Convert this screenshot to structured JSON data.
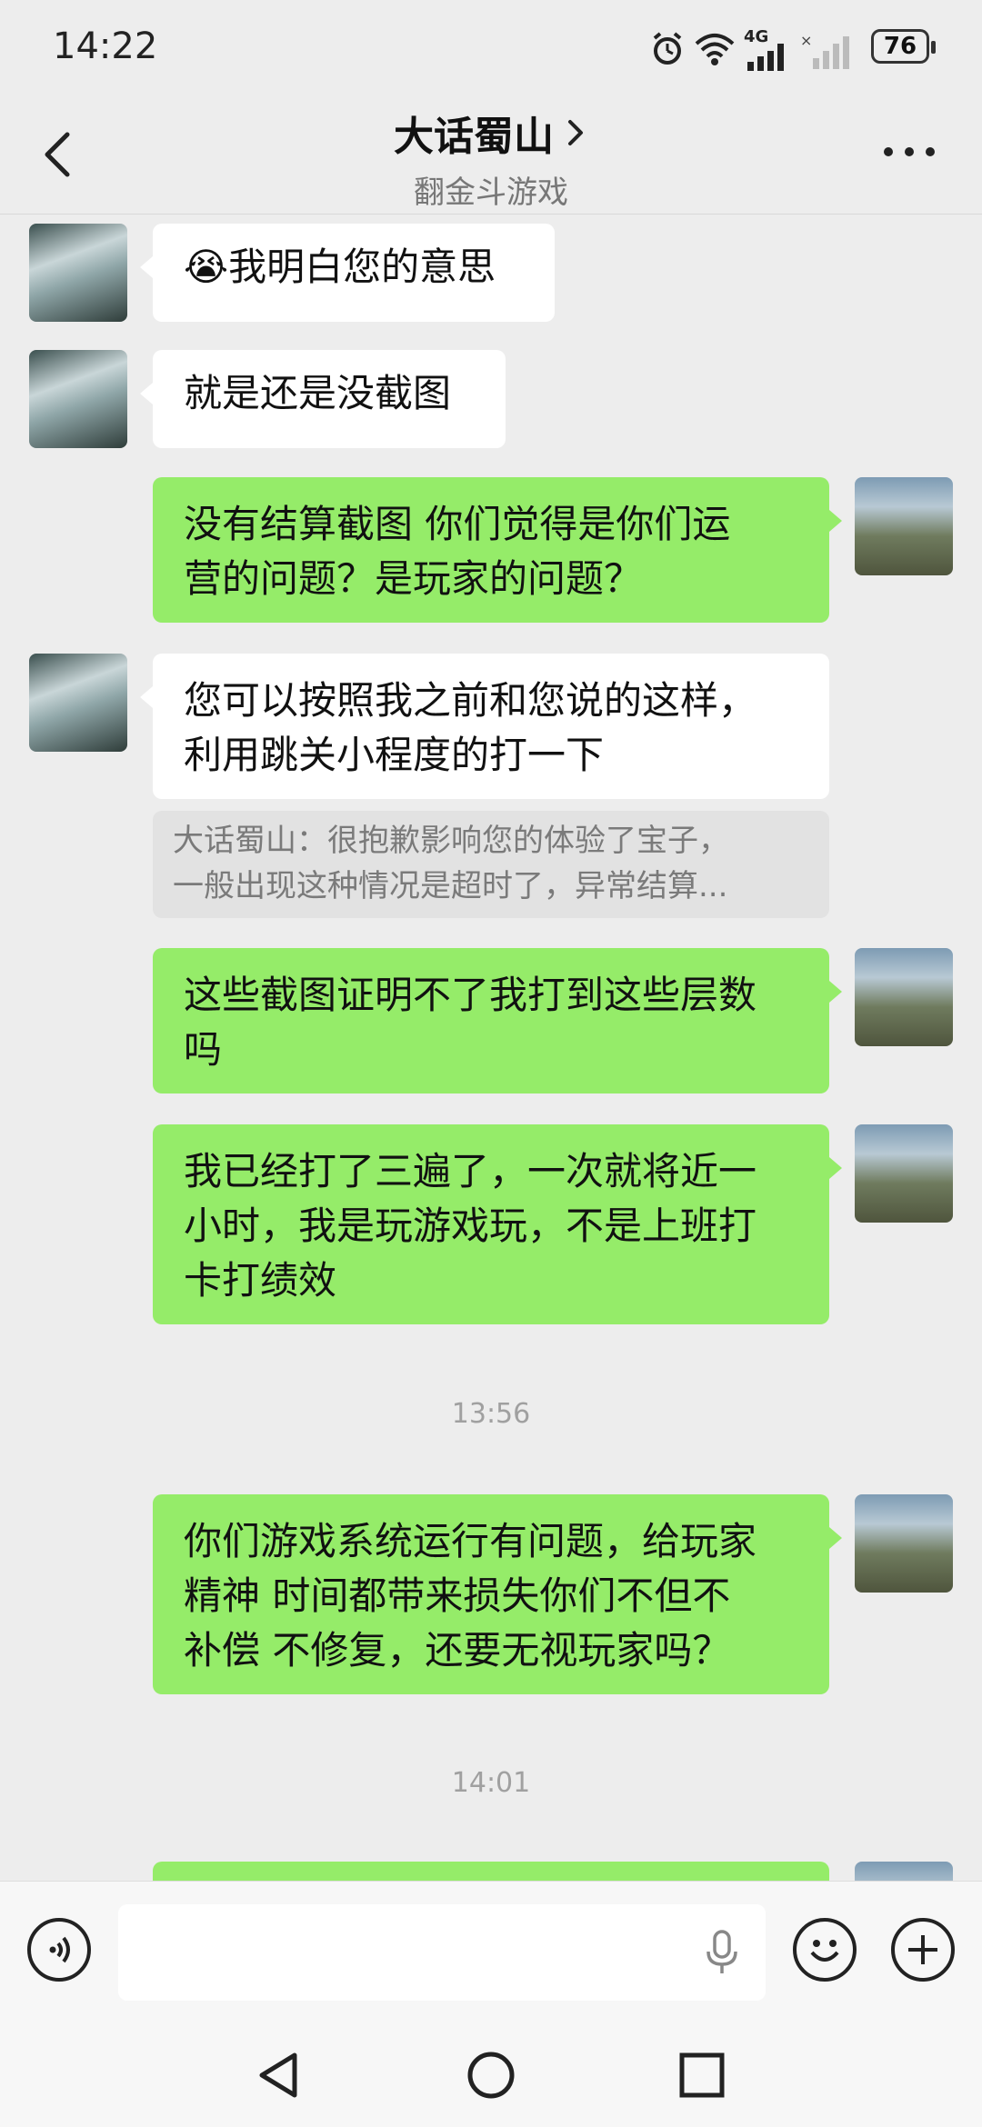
{
  "status_bar": {
    "time": "14:22",
    "network": "4G",
    "battery": "76",
    "icons": [
      "alarm-icon",
      "wifi-icon",
      "signal-icon",
      "signal-nosim-icon",
      "battery-icon"
    ]
  },
  "header": {
    "title": "大话蜀山",
    "subtitle": "翻金斗游戏",
    "back_icon": "chevron-left-icon",
    "title_chevron_icon": "chevron-right-icon",
    "more_icon": "more-dots-icon"
  },
  "messages": [
    {
      "side": "in",
      "emoji": "😭",
      "text": "我明白您的意思"
    },
    {
      "side": "in",
      "text": "就是还是没截图"
    },
    {
      "side": "out",
      "lines": [
        "没有结算截图 你们觉得是你们运",
        "营的问题？是玩家的问题？"
      ]
    },
    {
      "side": "in",
      "lines": [
        "您可以按照我之前和您说的这样，",
        "利用跳关小程度的打一下"
      ]
    },
    {
      "side": "quote",
      "lines": [
        "大话蜀山：很抱歉影响您的体验了宝子，",
        "一般出现这种情况是超时了，异常结算..."
      ]
    },
    {
      "side": "out",
      "lines": [
        "这些截图证明不了我打到这些层数",
        "吗"
      ]
    },
    {
      "side": "out",
      "lines": [
        "我已经打了三遍了，一次就将近一",
        "小时，我是玩游戏玩，不是上班打",
        "卡打绩效"
      ]
    },
    {
      "side": "time",
      "text": "13:56"
    },
    {
      "side": "out",
      "lines": [
        "你们游戏系统运行有问题，给玩家",
        "精神 时间都带来损失你们不但不",
        "补偿 不修复，还要无视玩家吗？"
      ]
    },
    {
      "side": "time",
      "text": "14:01"
    }
  ],
  "input_bar": {
    "voice_icon": "voice-icon",
    "mic_icon": "microphone-icon",
    "emoji_icon": "emoji-icon",
    "plus_icon": "plus-icon"
  },
  "nav_bar": {
    "back_icon": "nav-back-icon",
    "home_icon": "nav-home-icon",
    "recents_icon": "nav-recents-icon"
  },
  "colors": {
    "background": "#ededed",
    "outgoing_bubble": "#95ec69",
    "incoming_bubble": "#ffffff",
    "quote_bg": "#e2e2e2"
  }
}
